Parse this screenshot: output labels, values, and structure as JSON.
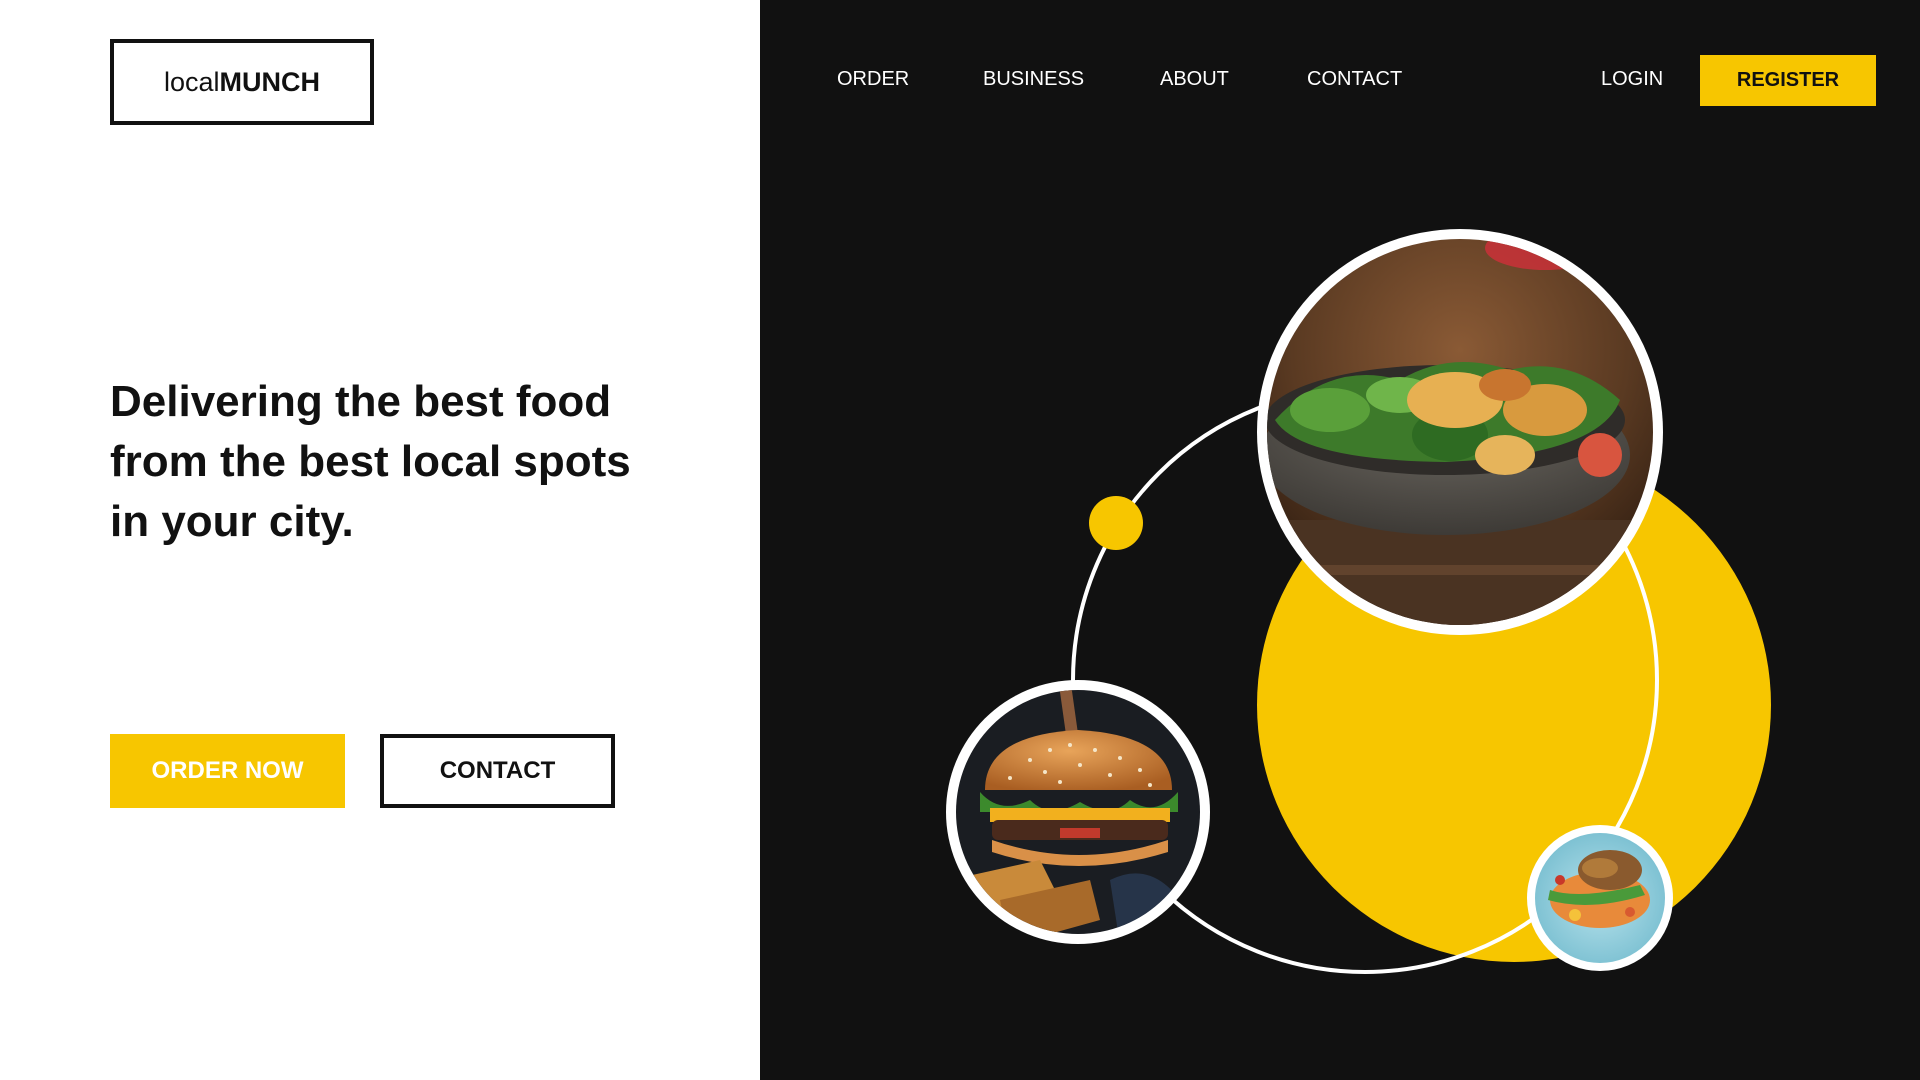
{
  "brand": {
    "logo_light": "local",
    "logo_bold": "MUNCH"
  },
  "nav": {
    "items": [
      {
        "label": "ORDER"
      },
      {
        "label": "BUSINESS"
      },
      {
        "label": "ABOUT"
      },
      {
        "label": "CONTACT"
      }
    ],
    "login_label": "LOGIN",
    "register_label": "REGISTER"
  },
  "hero": {
    "headline_lines": [
      "Delivering the best food",
      "from the best local spots",
      "in your city."
    ],
    "order_button_label": "ORDER NOW",
    "contact_button_label": "CONTACT"
  },
  "images": [
    {
      "name": "salad-bowl-photo"
    },
    {
      "name": "burger-photo"
    },
    {
      "name": "grilled-fish-plate-photo"
    }
  ],
  "colors": {
    "accent": "#f7c600",
    "dark": "#111111",
    "light": "#ffffff"
  }
}
